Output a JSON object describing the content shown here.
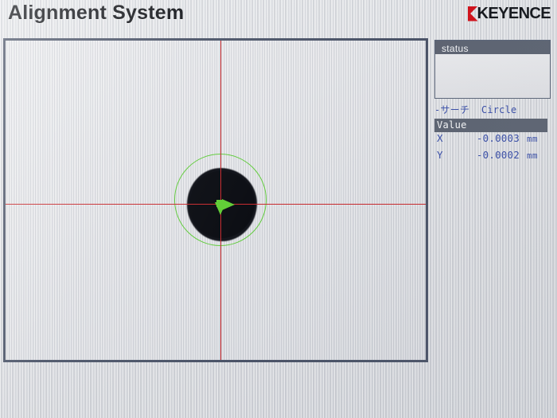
{
  "header": {
    "title": "Alignment System",
    "brand": "KEYENCE"
  },
  "viewport": {
    "name": "camera-image-view",
    "overlays": {
      "crosshair_color": "#c7282c",
      "found_circle_color": "#5fcb3a",
      "offset_arrow_color": "#5ecc32"
    }
  },
  "sidepanel": {
    "status": {
      "header": "status",
      "body": ""
    },
    "search": {
      "label": "-サーチ",
      "tool": "Circle"
    },
    "value_table": {
      "header": "Value",
      "rows": [
        {
          "axis": "X",
          "value": "-0.0003",
          "unit": "mm"
        },
        {
          "axis": "Y",
          "value": "-0.0002",
          "unit": "mm"
        }
      ]
    }
  }
}
